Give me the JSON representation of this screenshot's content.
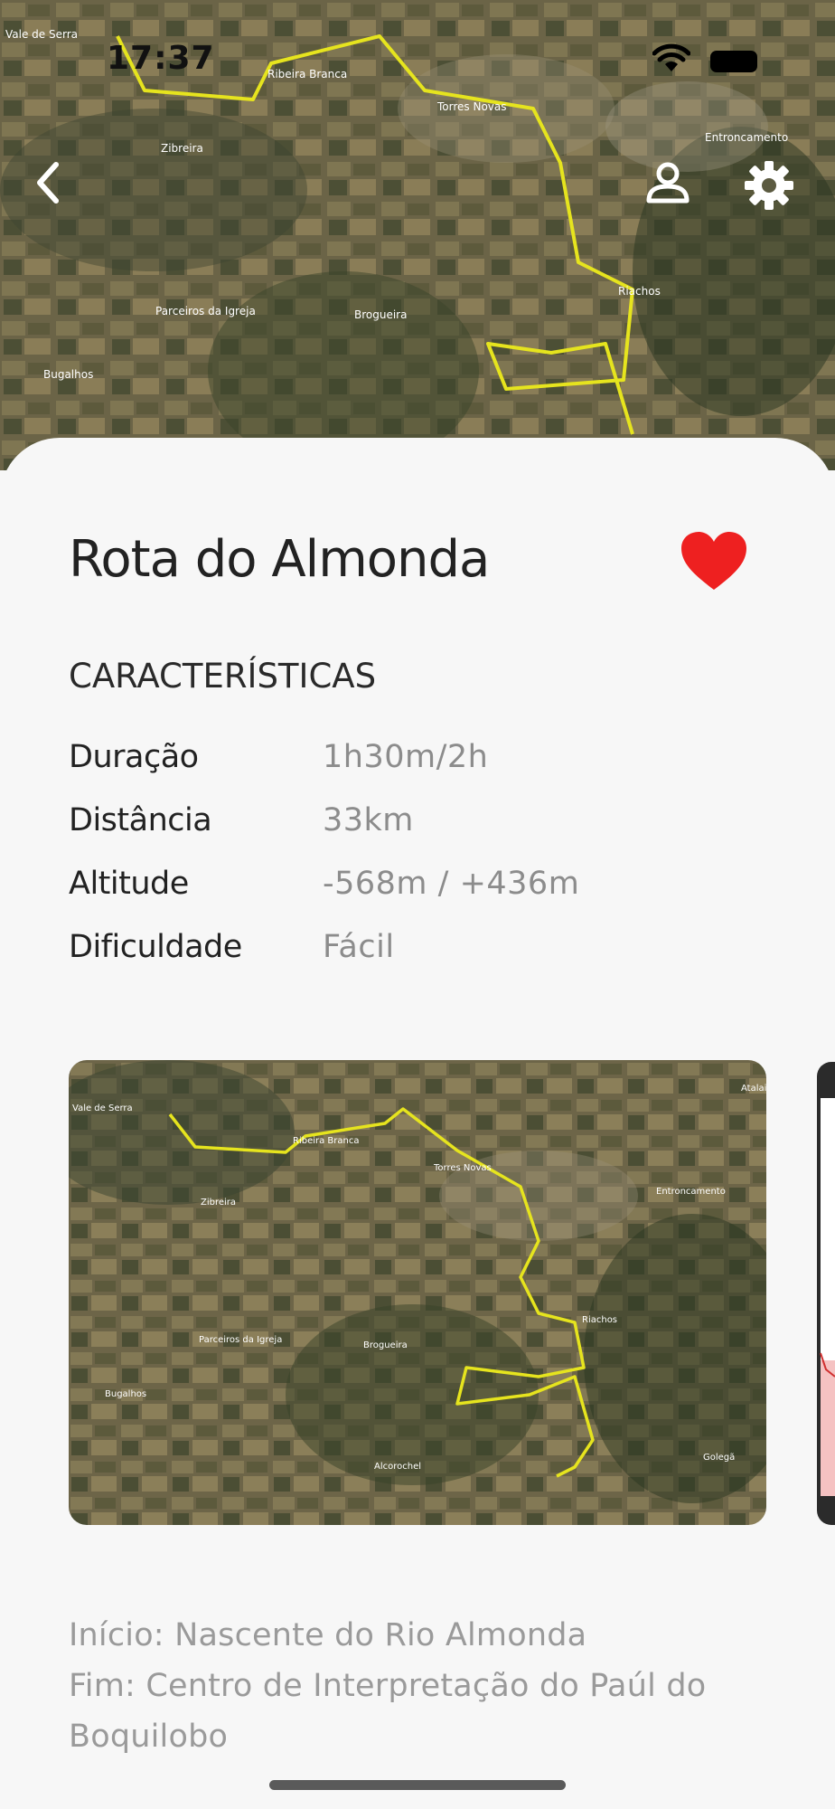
{
  "status_bar": {
    "time": "17:37"
  },
  "map_labels": {
    "vale_de_serra": "Vale de Serra",
    "ribeira_branca": "Ribeira Branca",
    "torres_novas": "Torres Novas",
    "entroncamento": "Entroncamento",
    "zibreira": "Zibreira",
    "riachos": "Riachos",
    "parceiros_da_igreja": "Parceiros da Igreja",
    "brogueira": "Brogueira",
    "bugalhos": "Bugalhos",
    "alcorochel": "Alcorochel",
    "golega": "Golegã",
    "atalaia": "Atalaia"
  },
  "route": {
    "title": "Rota do Almonda",
    "is_favorite": true
  },
  "characteristics": {
    "heading": "CARACTERÍSTICAS",
    "rows": [
      {
        "label": "Duração",
        "value": "1h30m/2h"
      },
      {
        "label": "Distância",
        "value": "33km"
      },
      {
        "label": "Altitude",
        "value": "-568m / +436m"
      },
      {
        "label": "Dificuldade",
        "value": "Fácil"
      }
    ]
  },
  "description": {
    "start": "Início: Nascente do Rio Almonda",
    "end": "Fim: Centro de Interpretação do Paúl do Boquilobo"
  },
  "colors": {
    "accent_heart": "#ee2020",
    "route_line": "#e6e41e",
    "sheet_bg": "#f7f7f7"
  },
  "icons": {
    "back": "chevron-left-icon",
    "user": "user-icon",
    "settings": "gear-icon",
    "favorite": "heart-icon"
  }
}
